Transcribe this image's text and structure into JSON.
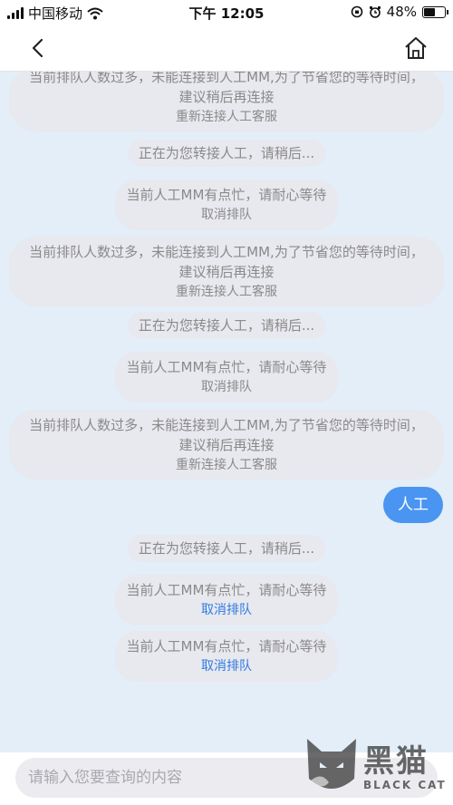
{
  "status": {
    "carrier": "中国移动",
    "time": "下午 12:05",
    "battery_text": "48%",
    "battery_level": 0.48
  },
  "nav": {
    "back_icon": "chevron-left-icon",
    "home_icon": "home-icon"
  },
  "messages": [
    {
      "kind": "long",
      "text": "当前排队人数过多，未能连接到人工MM,为了节省您的等待时间，建议稍后再连接",
      "action": "重新连接人工客服",
      "clipped": true
    },
    {
      "kind": "short",
      "text": "正在为您转接人工，请稍后..."
    },
    {
      "kind": "mid",
      "text": "当前人工MM有点忙，请耐心等待",
      "action": "取消排队"
    },
    {
      "kind": "long",
      "text": "当前排队人数过多，未能连接到人工MM,为了节省您的等待时间，建议稍后再连接",
      "action": "重新连接人工客服"
    },
    {
      "kind": "short",
      "text": "正在为您转接人工，请稍后..."
    },
    {
      "kind": "mid",
      "text": "当前人工MM有点忙，请耐心等待",
      "action": "取消排队"
    },
    {
      "kind": "long",
      "text": "当前排队人数过多，未能连接到人工MM,为了节省您的等待时间，建议稍后再连接",
      "action": "重新连接人工客服"
    },
    {
      "kind": "user",
      "text": "人工"
    },
    {
      "kind": "short",
      "text": "正在为您转接人工，请稍后..."
    },
    {
      "kind": "mid",
      "text": "当前人工MM有点忙，请耐心等待",
      "action": "取消排队",
      "action_active": true
    },
    {
      "kind": "mid",
      "text": "当前人工MM有点忙，请耐心等待",
      "action": "取消排队",
      "action_active": true
    }
  ],
  "input": {
    "placeholder": "请输入您要查询的内容",
    "value": ""
  },
  "watermark": {
    "cn": "黑猫",
    "en": "BLACK CAT"
  },
  "colors": {
    "chat_bg": "#e3eef9",
    "user_bubble": "#4a95f1",
    "system_bubble": "#e8e8ef",
    "action_link": "#2e7be0"
  }
}
